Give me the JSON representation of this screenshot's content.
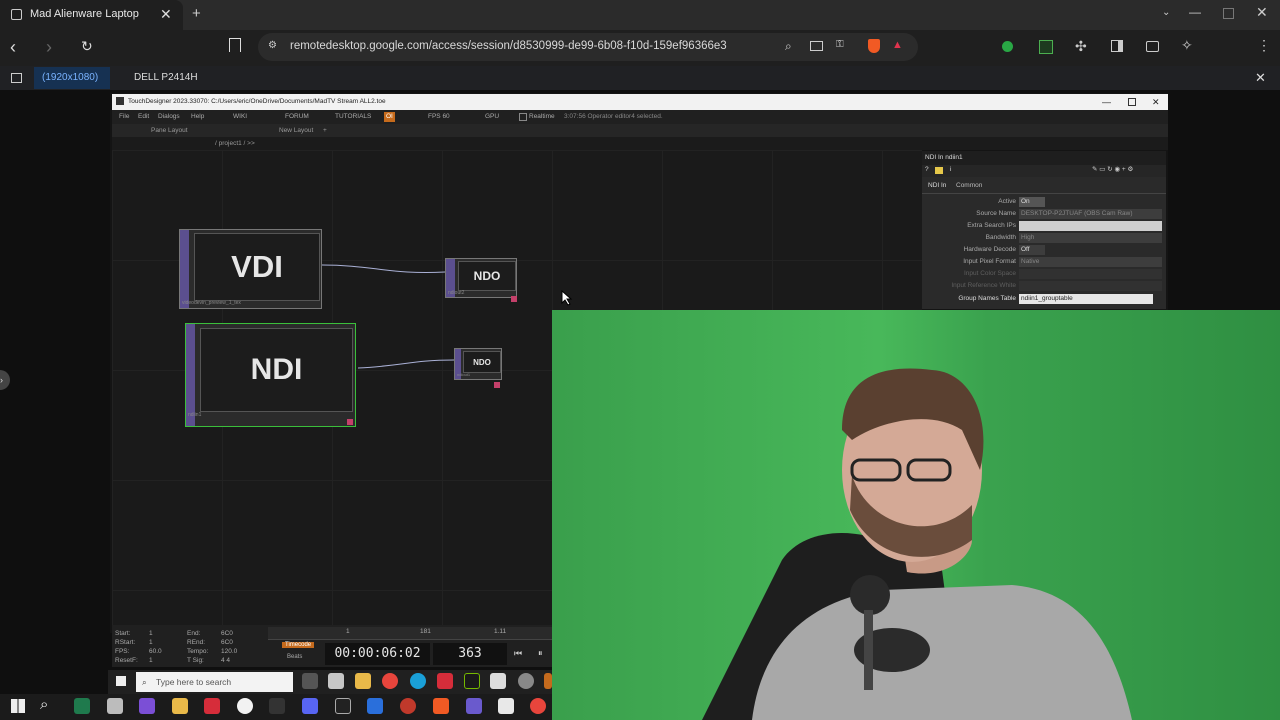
{
  "browser": {
    "tab_title": "Mad Alienware Laptop",
    "url": "remotedesktop.google.com/access/session/d8530999-de99-6b08-f10d-159ef96366e3"
  },
  "remote_bar": {
    "tab1": "(1920x1080)",
    "tab2": "DELL P2414H"
  },
  "touchdesigner": {
    "title": "TouchDesigner 2023.33070: C:/Users/eric/OneDrive/Documents/MadTV Stream ALL2.toe",
    "menu": [
      "File",
      "Edit",
      "Dialogs",
      "Help"
    ],
    "top_buttons": [
      "WIKI",
      "FORUM",
      "TUTORIALS",
      "FPS 60",
      "GPU"
    ],
    "realtime": "Realtime",
    "status": "3:07:56 Operator editor4 selected.",
    "pane_layout": "Pane Layout",
    "new_layout": "New Layout",
    "path": "/ project1 / >>",
    "nodes": [
      {
        "label": "VDI",
        "caption": "videodevin_preview_1_tex"
      },
      {
        "label": "NDO",
        "caption": "ndiout2"
      },
      {
        "label": "NDI",
        "caption": "ndiin1"
      },
      {
        "label": "NDO",
        "caption": "ndiout1"
      }
    ],
    "params": {
      "header": "NDI In  ndiin1",
      "tabs": [
        "NDI In",
        "Common"
      ],
      "rows": [
        {
          "label": "Active",
          "value": "On"
        },
        {
          "label": "Source Name",
          "value": "DESKTOP-P2JTUAF (OBS Cam Raw)"
        },
        {
          "label": "Extra Search IPs",
          "value": ""
        },
        {
          "label": "Bandwidth",
          "value": "High"
        },
        {
          "label": "Hardware Decode",
          "value": "Off"
        },
        {
          "label": "Input Pixel Format",
          "value": "Native"
        },
        {
          "label": "Input Color Space",
          "value": ""
        },
        {
          "label": "Input Reference White",
          "value": ""
        },
        {
          "label": "Group Names Table",
          "value": "ndiin1_grouptable"
        }
      ]
    },
    "timebar": {
      "start": "Start:",
      "start_v": "1",
      "end": "End:",
      "end_v": "6C0",
      "rstart": "RStart:",
      "rstart_v": "1",
      "rend": "REnd:",
      "rend_v": "6C0",
      "fps": "FPS:",
      "fps_v": "60.0",
      "tempo": "Tempo:",
      "tempo_v": "120.0",
      "reset": "ResetF:",
      "reset_v": "1",
      "tsig": "T Sig:",
      "tsig_v": "4  4",
      "timecode_label": "Timecode",
      "beats_label": "Beats",
      "timecode": "00:00:06:02",
      "frame": "363",
      "ruler": [
        "1",
        "181",
        "1.11"
      ]
    }
  },
  "remote_taskbar": {
    "search_placeholder": "Type here to search"
  }
}
